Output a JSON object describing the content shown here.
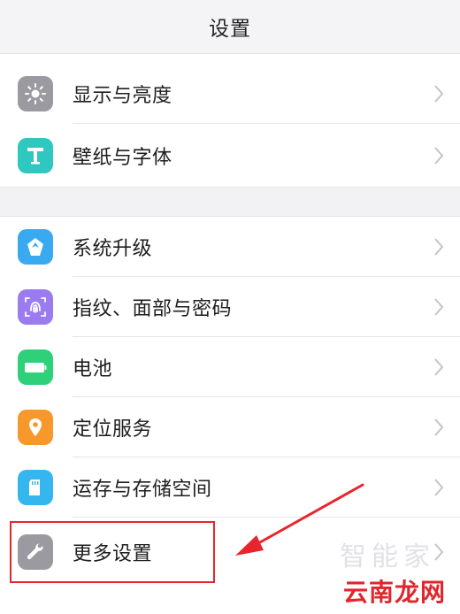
{
  "header": {
    "title": "设置"
  },
  "rows": [
    {
      "label": "显示与亮度",
      "icon": "sun-icon",
      "color": "#9a9aa0"
    },
    {
      "label": "壁纸与字体",
      "icon": "text-t-icon",
      "color": "#2ec8c0"
    },
    {
      "label": "系统升级",
      "icon": "upgrade-icon",
      "color": "#3aaaf0"
    },
    {
      "label": "指纹、面部与密码",
      "icon": "fingerprint-icon",
      "color": "#9a7cf0"
    },
    {
      "label": "电池",
      "icon": "battery-icon",
      "color": "#2ed07a"
    },
    {
      "label": "定位服务",
      "icon": "location-icon",
      "color": "#f7982c"
    },
    {
      "label": "运存与存储空间",
      "icon": "sd-card-icon",
      "color": "#36b6ee"
    },
    {
      "label": "更多设置",
      "icon": "wrench-icon",
      "color": "#9a9aa0"
    }
  ],
  "watermark": {
    "faint": "智能家",
    "corner": "云南龙网"
  },
  "colors": {
    "highlight": "#e8242c"
  }
}
